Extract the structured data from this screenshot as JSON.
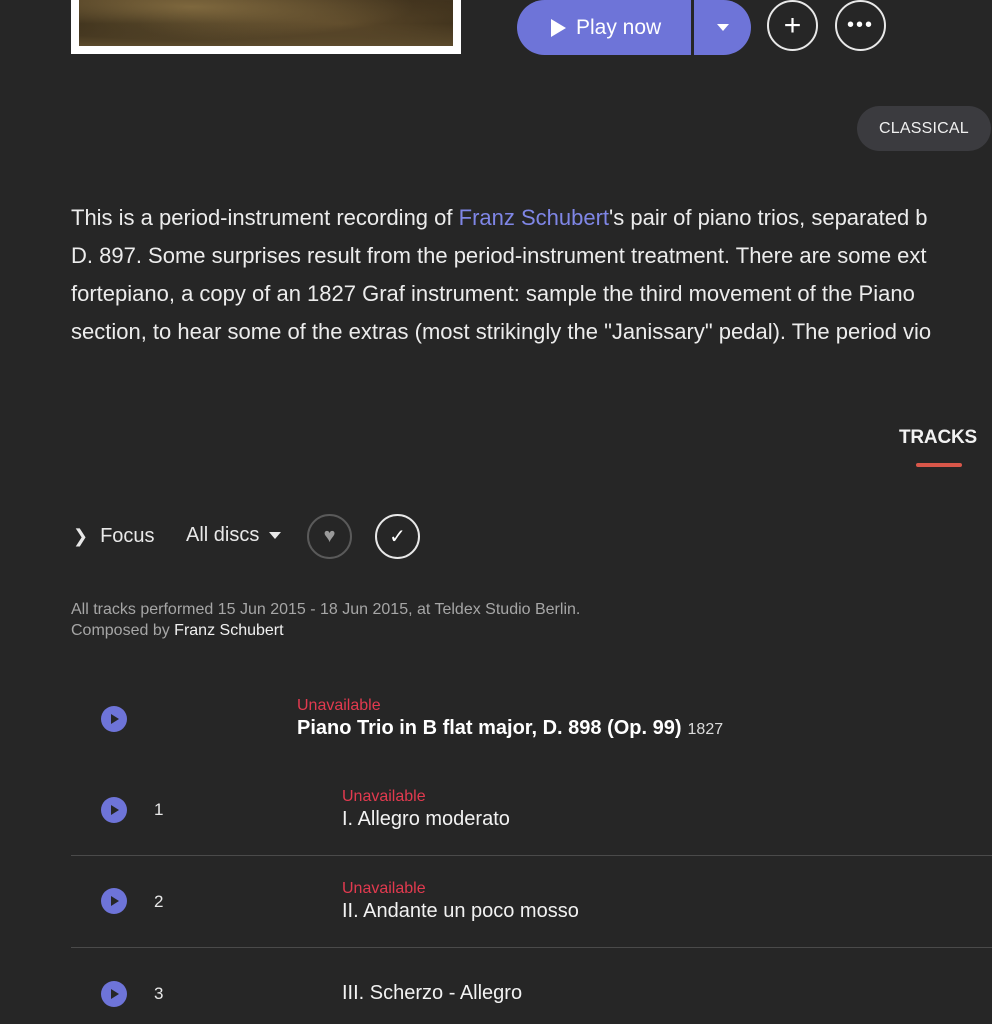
{
  "player": {
    "play_label": "Play now",
    "more_label": "•••"
  },
  "genre": "CLASSICAL",
  "description": {
    "line1_pre": "This is a period-instrument recording of ",
    "line1_link": "Franz Schubert",
    "line1_post": "'s pair of piano trios, separated b",
    "line2": "D. 897. Some surprises result from the period-instrument treatment. There are some ext",
    "line3": "fortepiano, a copy of an 1827 Graf instrument: sample the third movement of the Piano",
    "line4": "section, to hear some of the extras (most strikingly the \"Janissary\" pedal). The period vio"
  },
  "tabs": {
    "tracks_label": "TRACKS"
  },
  "filters": {
    "focus_label": "Focus",
    "discs_label": "All discs"
  },
  "performance": {
    "info": "All tracks performed 15 Jun 2015 - 18 Jun 2015, at Teldex Studio Berlin.",
    "composed_by": "Composed by ",
    "composer": "Franz Schubert"
  },
  "work": {
    "status": "Unavailable",
    "title": "Piano Trio in B flat major, D. 898 (Op. 99)",
    "year": "1827"
  },
  "tracks": [
    {
      "number": "1",
      "status": "Unavailable",
      "title": "I. Allegro moderato"
    },
    {
      "number": "2",
      "status": "Unavailable",
      "title": "II. Andante un poco mosso"
    },
    {
      "number": "3",
      "status": "",
      "title": "III. Scherzo - Allegro"
    }
  ],
  "colors": {
    "accent": "#6e74d8",
    "background": "#262626",
    "unavailable": "#e23a4f",
    "tab_underline": "#d9574a"
  }
}
